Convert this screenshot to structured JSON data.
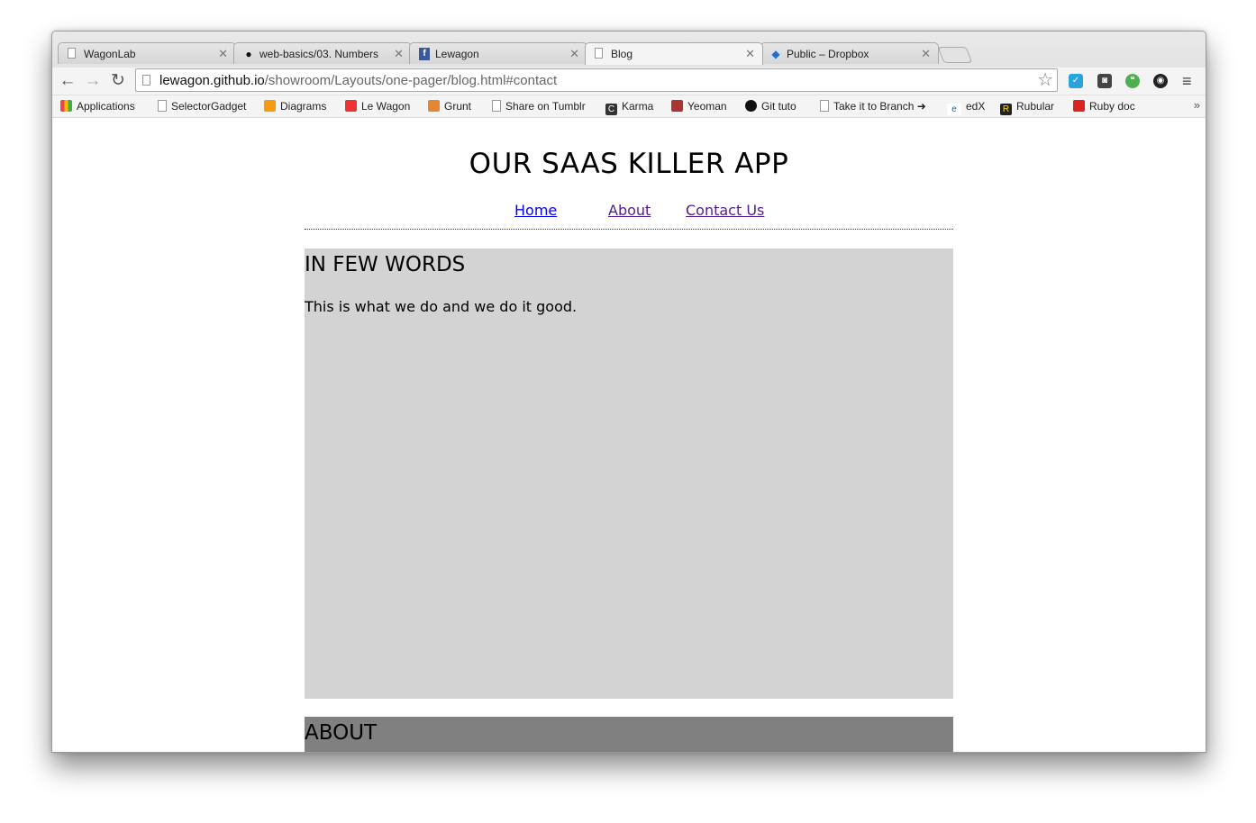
{
  "browser": {
    "tabs": [
      {
        "title": "WagonLab",
        "favicon": "page-icon",
        "active": false
      },
      {
        "title": "web-basics/03. Numbers",
        "favicon": "github-icon",
        "active": false
      },
      {
        "title": "Lewagon",
        "favicon": "facebook-icon",
        "active": false
      },
      {
        "title": "Blog",
        "favicon": "page-icon",
        "active": true
      },
      {
        "title": "Public – Dropbox",
        "favicon": "dropbox-icon",
        "active": false
      }
    ],
    "url": {
      "host": "lewagon.github.io",
      "path": "/showroom/Layouts/one-pager/blog.html#contact"
    },
    "bookmarks": [
      {
        "label": "Applications",
        "icon": "apps-grid-icon"
      },
      {
        "label": "SelectorGadget",
        "icon": "page-icon"
      },
      {
        "label": "Diagrams",
        "icon": "diagrams-icon"
      },
      {
        "label": "Le Wagon",
        "icon": "lewagon-icon"
      },
      {
        "label": "Grunt",
        "icon": "grunt-icon"
      },
      {
        "label": "Share on Tumblr",
        "icon": "page-icon"
      },
      {
        "label": "Karma",
        "icon": "karma-icon"
      },
      {
        "label": "Yeoman",
        "icon": "yeoman-icon"
      },
      {
        "label": "Git tuto",
        "icon": "github-icon"
      },
      {
        "label": "Take it to Branch ➜",
        "icon": "page-icon"
      },
      {
        "label": "edX",
        "icon": "edx-icon"
      },
      {
        "label": "Rubular",
        "icon": "rubular-icon"
      },
      {
        "label": "Ruby doc",
        "icon": "ruby-icon"
      }
    ],
    "more_bookmarks": "»"
  },
  "page": {
    "title": "OUR SAAS KILLER APP",
    "nav": {
      "home": "Home",
      "about": "About",
      "contact": "Contact Us"
    },
    "intro": {
      "heading": "IN FEW WORDS",
      "body": "This is what we do and we do it good."
    },
    "about": {
      "heading": "ABOUT"
    }
  },
  "colors": {
    "intro_bg": "#d3d3d3",
    "about_bg": "#808080",
    "link": "#0000ee",
    "link_visited": "#551a8b"
  }
}
